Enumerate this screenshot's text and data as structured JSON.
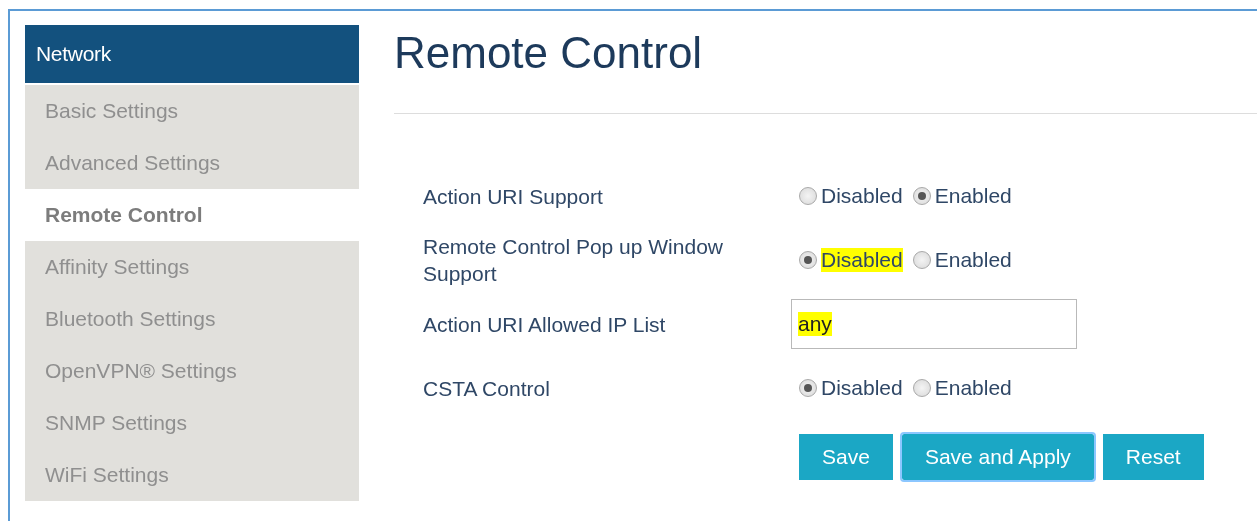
{
  "sidebar": {
    "header": "Network",
    "items": [
      {
        "label": "Basic Settings",
        "selected": false
      },
      {
        "label": "Advanced Settings",
        "selected": false
      },
      {
        "label": "Remote Control",
        "selected": true
      },
      {
        "label": "Affinity Settings",
        "selected": false
      },
      {
        "label": "Bluetooth Settings",
        "selected": false
      },
      {
        "label": "OpenVPN® Settings",
        "selected": false
      },
      {
        "label": "SNMP Settings",
        "selected": false
      },
      {
        "label": "WiFi Settings",
        "selected": false
      }
    ]
  },
  "page": {
    "title": "Remote Control"
  },
  "form": [
    {
      "kind": "radio",
      "label": "Action URI Support",
      "options": [
        {
          "label": "Disabled",
          "selected": false,
          "highlighted": false
        },
        {
          "label": "Enabled",
          "selected": true,
          "highlighted": false
        }
      ]
    },
    {
      "kind": "radio",
      "label": "Remote Control Pop up Window Support",
      "options": [
        {
          "label": "Disabled",
          "selected": true,
          "highlighted": true
        },
        {
          "label": "Enabled",
          "selected": false,
          "highlighted": false
        }
      ]
    },
    {
      "kind": "text",
      "label": "Action URI Allowed IP List",
      "value": "any",
      "highlighted": true
    },
    {
      "kind": "radio",
      "label": "CSTA Control",
      "options": [
        {
          "label": "Disabled",
          "selected": true,
          "highlighted": false
        },
        {
          "label": "Enabled",
          "selected": false,
          "highlighted": false
        }
      ]
    }
  ],
  "buttons": [
    {
      "label": "Save",
      "focused": false
    },
    {
      "label": "Save and Apply",
      "focused": true
    },
    {
      "label": "Reset",
      "focused": false
    }
  ]
}
